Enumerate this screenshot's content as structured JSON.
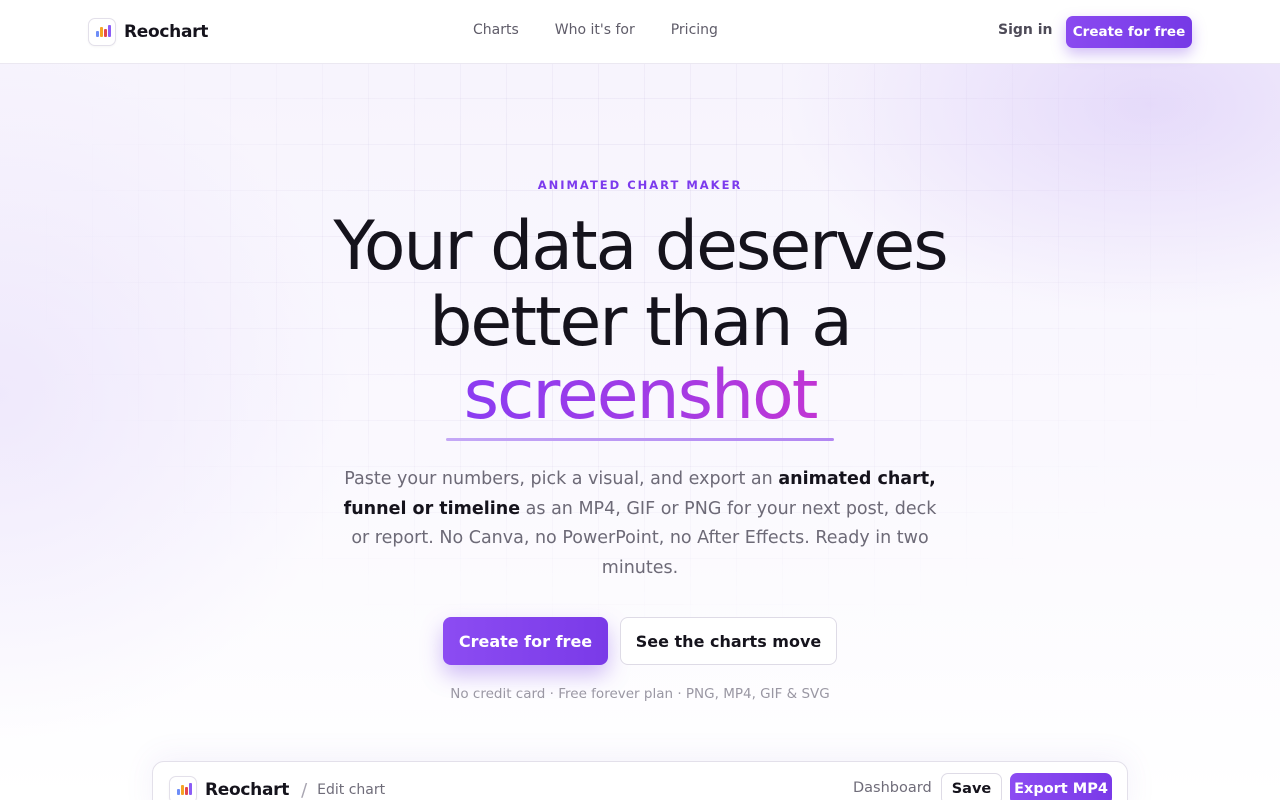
{
  "nav": {
    "brand": "Reochart",
    "links": [
      "Charts",
      "Who it's for",
      "Pricing"
    ],
    "signin": "Sign in",
    "cta": "Create for free"
  },
  "hero": {
    "eyebrow": "ANIMATED CHART MAKER",
    "line1": "Your data deserves",
    "line2": "better than a",
    "highlight": "screenshot",
    "desc_1": "Paste your numbers, pick a visual, and export an ",
    "desc_bold_1": "animated chart, funnel or timeline",
    "desc_2": " as an MP4, GIF or PNG for your next post, deck or report. No Canva, no PowerPoint, no After Effects. Ready in two minutes.",
    "cta_primary": "Create for free",
    "cta_secondary": "See the charts move",
    "fineprint": "No credit card · Free forever plan · PNG, MP4, GIF & SVG"
  },
  "editor": {
    "brand": "Reochart",
    "separator": "/",
    "crumb": "Edit chart",
    "dashboard": "Dashboard",
    "save": "Save",
    "export": "Export MP4"
  },
  "colors": {
    "accent": "#7c3aed",
    "logo_bars": [
      "#6d8df7",
      "#f5a524",
      "#e5484d",
      "#8b5cf6"
    ]
  }
}
